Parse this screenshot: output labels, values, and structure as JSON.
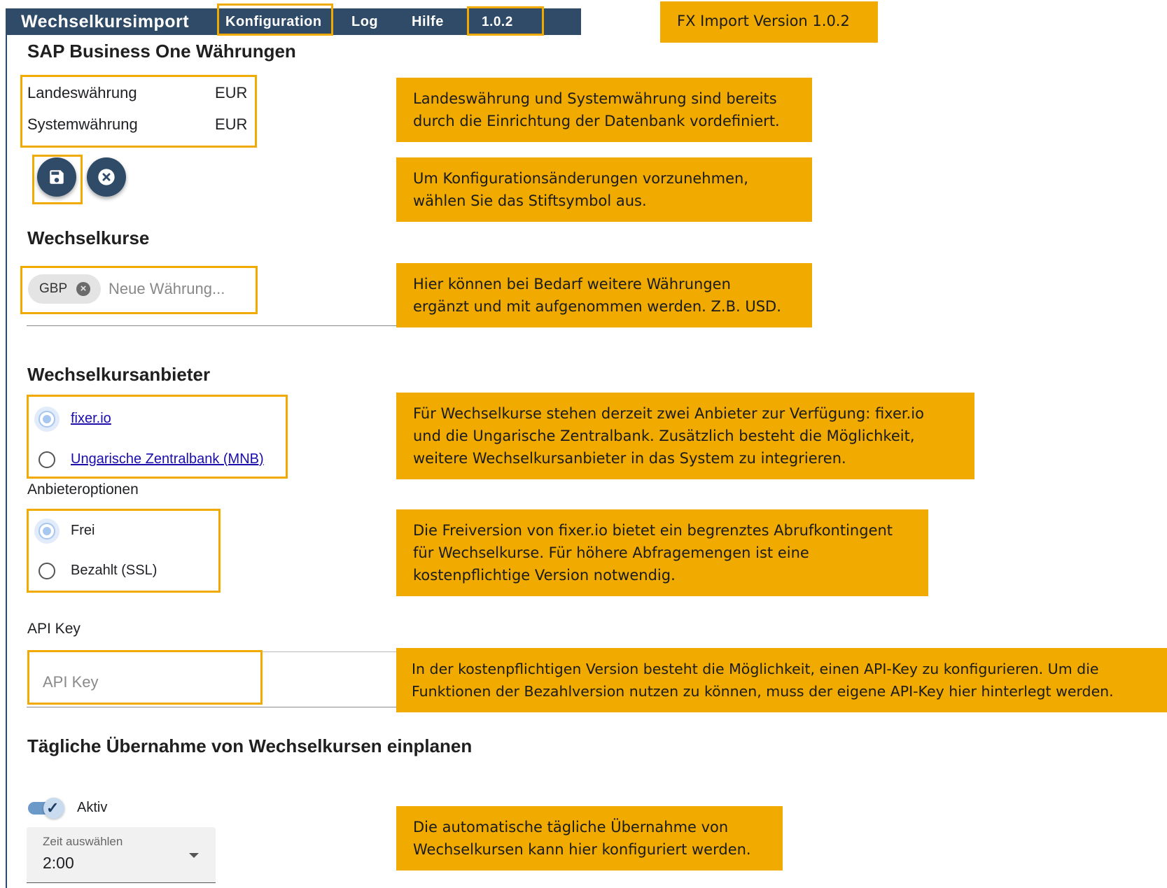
{
  "topbar": {
    "title": "Wechselkursimport",
    "menu": [
      "Konfiguration",
      "Log",
      "Hilfe"
    ],
    "version": "1.0.2"
  },
  "version_note": "FX Import Version 1.0.2",
  "currencies": {
    "heading": "SAP Business One Währungen",
    "local_label": "Landeswährung",
    "local_value": "EUR",
    "system_label": "Systemwährung",
    "system_value": "EUR"
  },
  "actions": {
    "save_icon": "save-icon",
    "cancel_icon": "cancel-icon"
  },
  "rates": {
    "heading": "Wechselkurse",
    "chip": "GBP",
    "placeholder": "Neue Währung..."
  },
  "provider": {
    "heading": "Wechselkursanbieter",
    "options": [
      "fixer.io",
      "Ungarische Zentralbank (MNB)"
    ],
    "selected": "fixer.io",
    "options_heading": "Anbieteroptionen",
    "plan_options": [
      "Frei",
      "Bezahlt (SSL)"
    ],
    "plan_selected": "Frei",
    "api_label": "API Key",
    "api_placeholder": "API Key"
  },
  "schedule": {
    "heading": "Tägliche Übernahme von Wechselkursen einplanen",
    "toggle_label": "Aktiv",
    "toggle_on": true,
    "time_label": "Zeit auswählen",
    "time_value": "2:00"
  },
  "callouts": {
    "c1": [
      "Landeswährung und Systemwährung sind bereits",
      "durch die Einrichtung der Datenbank vordefiniert."
    ],
    "c2": [
      "Um Konfigurationsänderungen vorzunehmen,",
      "wählen Sie das Stiftsymbol aus."
    ],
    "c3": [
      "Hier können bei Bedarf weitere Währungen",
      "ergänzt und mit aufgenommen werden. Z.B. USD."
    ],
    "c4": [
      "Für Wechselkurse stehen derzeit zwei Anbieter zur Verfügung: fixer.io",
      "und die Ungarische Zentralbank. Zusätzlich besteht die Möglichkeit,",
      "weitere Wechselkursanbieter in das System zu integrieren."
    ],
    "c5": [
      "Die Freiversion von fixer.io bietet ein begrenztes Abrufkontingent",
      "für Wechselkurse. Für höhere Abfragemengen ist eine",
      "kostenpflichtige Version notwendig."
    ],
    "c6": [
      "In der kostenpflichtigen Version besteht die Möglichkeit, einen API-Key zu konfigurieren. Um die",
      "Funktionen der Bezahlversion nutzen zu können, muss der eigene API-Key hier hinterlegt werden."
    ],
    "c7": [
      "Die automatische tägliche Übernahme von",
      "Wechselkursen kann hier konfiguriert werden."
    ]
  },
  "colors": {
    "topbar": "#2f4b67",
    "highlight": "#f0aa00",
    "callout": "#f0aa00"
  }
}
